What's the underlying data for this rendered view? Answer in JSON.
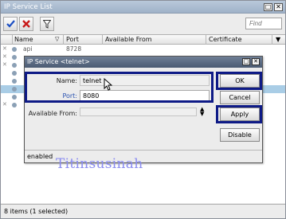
{
  "window": {
    "title": "IP Service List"
  },
  "search": {
    "placeholder": "Find"
  },
  "table": {
    "columns": [
      "Name",
      "Port",
      "Available From",
      "Certificate"
    ],
    "rows": [
      {
        "name": "api",
        "port": "8728"
      }
    ]
  },
  "status": {
    "text": "8 items (1 selected)"
  },
  "dialog": {
    "title": "IP Service <telnet>",
    "name_label": "Name:",
    "name_value": "telnet",
    "port_label": "Port:",
    "port_value": "8080",
    "available_label": "Available From:",
    "available_value": "",
    "buttons": {
      "ok": "OK",
      "cancel": "Cancel",
      "apply": "Apply",
      "disable": "Disable"
    },
    "status": "enabled"
  },
  "watermark": "Titinsusinah",
  "colors": {
    "highlight_box": "#0e1a86",
    "selected_row": "#a9cde6",
    "dialog_title": "#4a5a72"
  }
}
